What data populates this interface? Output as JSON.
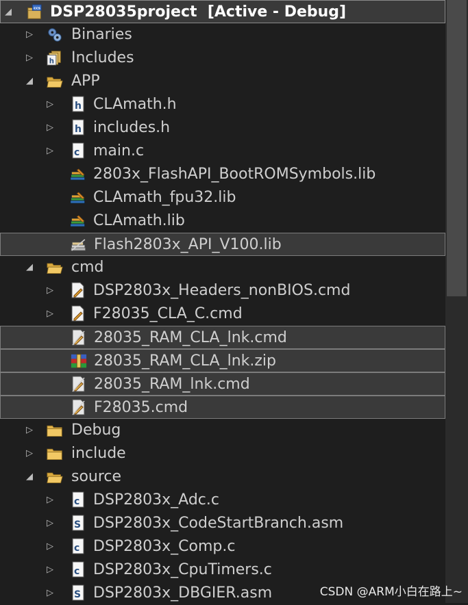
{
  "project": {
    "name": "DSP28035project",
    "state": "[Active - Debug]"
  },
  "tree": [
    {
      "id": "binaries",
      "label": "Binaries",
      "level": 1,
      "arrow": "collapsed",
      "icon": "binaries-icon"
    },
    {
      "id": "includes",
      "label": "Includes",
      "level": 1,
      "arrow": "collapsed",
      "icon": "includes-icon"
    },
    {
      "id": "app",
      "label": "APP",
      "level": 1,
      "arrow": "expanded",
      "icon": "folder-open-icon"
    },
    {
      "id": "clamath-h",
      "label": "CLAmath.h",
      "level": 2,
      "arrow": "collapsed",
      "icon": "header-file-icon"
    },
    {
      "id": "includes-h",
      "label": "includes.h",
      "level": 2,
      "arrow": "collapsed",
      "icon": "header-file-icon"
    },
    {
      "id": "main-c",
      "label": "main.c",
      "level": 2,
      "arrow": "collapsed",
      "icon": "c-file-icon"
    },
    {
      "id": "flashapi-bootrom",
      "label": "2803x_FlashAPI_BootROMSymbols.lib",
      "level": 2,
      "arrow": "none",
      "icon": "library-icon"
    },
    {
      "id": "clamath-fpu32",
      "label": "CLAmath_fpu32.lib",
      "level": 2,
      "arrow": "none",
      "icon": "library-icon"
    },
    {
      "id": "clamath-lib",
      "label": "CLAmath.lib",
      "level": 2,
      "arrow": "none",
      "icon": "library-icon"
    },
    {
      "id": "flash2803x-api",
      "label": "Flash2803x_API_V100.lib",
      "level": 2,
      "arrow": "none",
      "icon": "excluded-library-icon",
      "selected": true
    },
    {
      "id": "cmd",
      "label": "cmd",
      "level": 1,
      "arrow": "expanded",
      "icon": "folder-open-icon"
    },
    {
      "id": "headers-nonbios",
      "label": "DSP2803x_Headers_nonBIOS.cmd",
      "level": 2,
      "arrow": "collapsed",
      "icon": "cmd-file-icon"
    },
    {
      "id": "f28035-cla-c",
      "label": "F28035_CLA_C.cmd",
      "level": 2,
      "arrow": "collapsed",
      "icon": "cmd-file-icon"
    },
    {
      "id": "ram-cla-lnk-cmd",
      "label": "28035_RAM_CLA_lnk.cmd",
      "level": 2,
      "arrow": "none",
      "icon": "excluded-cmd-icon",
      "selected": true
    },
    {
      "id": "ram-cla-lnk-zip",
      "label": "28035_RAM_CLA_lnk.zip",
      "level": 2,
      "arrow": "none",
      "icon": "zip-archive-icon",
      "selected": true
    },
    {
      "id": "ram-lnk-cmd",
      "label": "28035_RAM_lnk.cmd",
      "level": 2,
      "arrow": "none",
      "icon": "excluded-cmd-icon",
      "selected": true
    },
    {
      "id": "f28035-cmd",
      "label": "F28035.cmd",
      "level": 2,
      "arrow": "none",
      "icon": "excluded-cmd-icon",
      "selected": true
    },
    {
      "id": "debug",
      "label": "Debug",
      "level": 1,
      "arrow": "collapsed",
      "icon": "folder-icon"
    },
    {
      "id": "include",
      "label": "include",
      "level": 1,
      "arrow": "collapsed",
      "icon": "folder-icon"
    },
    {
      "id": "source",
      "label": "source",
      "level": 1,
      "arrow": "expanded",
      "icon": "folder-open-icon"
    },
    {
      "id": "adc-c",
      "label": "DSP2803x_Adc.c",
      "level": 2,
      "arrow": "collapsed",
      "icon": "c-file-icon"
    },
    {
      "id": "codestartbranch",
      "label": "DSP2803x_CodeStartBranch.asm",
      "level": 2,
      "arrow": "collapsed",
      "icon": "asm-file-icon"
    },
    {
      "id": "comp-c",
      "label": "DSP2803x_Comp.c",
      "level": 2,
      "arrow": "collapsed",
      "icon": "c-file-icon"
    },
    {
      "id": "cputimers-c",
      "label": "DSP2803x_CpuTimers.c",
      "level": 2,
      "arrow": "collapsed",
      "icon": "c-file-icon"
    },
    {
      "id": "dbgier-asm",
      "label": "DSP2803x_DBGIER.asm",
      "level": 2,
      "arrow": "collapsed",
      "icon": "asm-file-icon"
    }
  ],
  "watermark": "CSDN @ARM小白在路上~"
}
